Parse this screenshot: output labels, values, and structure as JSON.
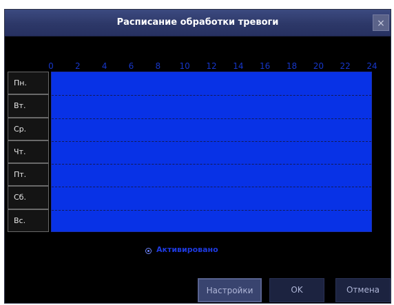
{
  "dialog": {
    "title": "Расписание обработки тревоги",
    "close_label": "×"
  },
  "hours": [
    "0",
    "2",
    "4",
    "6",
    "8",
    "10",
    "12",
    "14",
    "16",
    "18",
    "20",
    "22",
    "24"
  ],
  "days": [
    "Пн.",
    "Вт.",
    "Ср.",
    "Чт.",
    "Пт.",
    "Сб.",
    "Вс."
  ],
  "schedule": {
    "all_hours_active": true,
    "grid_color": "#0832e6"
  },
  "activation": {
    "label": "Активировано",
    "selected": true
  },
  "buttons": {
    "settings": "Настройки",
    "ok": "OK",
    "cancel": "Отмена"
  }
}
